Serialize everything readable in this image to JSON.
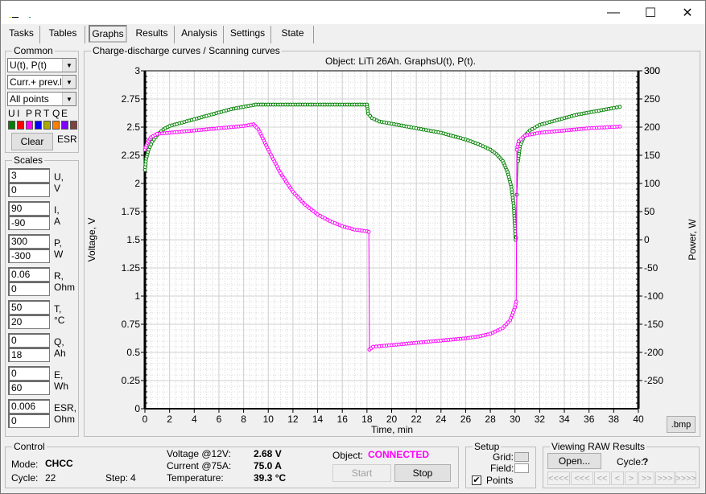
{
  "window": {
    "minimize_glyph": "—",
    "maximize_glyph": "☐",
    "close_glyph": "✕"
  },
  "tabs": [
    {
      "label": "Tasks",
      "active": false
    },
    {
      "label": "Tables",
      "active": false
    },
    {
      "label": "Graphs",
      "active": true
    },
    {
      "label": "Results",
      "active": false
    },
    {
      "label": "Analysis",
      "active": false
    },
    {
      "label": "Settings",
      "active": false
    },
    {
      "label": "State",
      "active": false
    }
  ],
  "common": {
    "title": "Common",
    "graph_select": "U(t), P(t)",
    "curve_select": "Curr.+ prev.L",
    "points_select": "All points",
    "legend_letters": [
      "U",
      "I",
      "P",
      "R",
      "T",
      "Q",
      "E"
    ],
    "legend_colors": [
      "#008000",
      "#ff0000",
      "#ff00ff",
      "#0000ff",
      "#aaaa00",
      "#ff8000",
      "#8000ff",
      "#804040"
    ],
    "clear_label": "Clear",
    "esr_label": "ESR"
  },
  "scales": {
    "title": "Scales",
    "rows": [
      {
        "max": "3",
        "min": "0",
        "unit1": "U,",
        "unit2": "V"
      },
      {
        "max": "90",
        "min": "-90",
        "unit1": "I,",
        "unit2": "A"
      },
      {
        "max": "300",
        "min": "-300",
        "unit1": "P,",
        "unit2": "W"
      },
      {
        "max": "0.06",
        "min": "0",
        "unit1": "R,",
        "unit2": "Ohm"
      },
      {
        "max": "50",
        "min": "20",
        "unit1": "T,",
        "unit2": "°C"
      },
      {
        "max": "0",
        "min": "18",
        "unit1": "Q,",
        "unit2": "Ah"
      },
      {
        "max": "0",
        "min": "60",
        "unit1": "E,",
        "unit2": "Wh"
      },
      {
        "max": "0.006",
        "min": "0",
        "unit1": "ESR,",
        "unit2": "Ohm"
      }
    ]
  },
  "graph_panel": {
    "title": "Charge-discharge curves / Scanning curves",
    "bmp_label": ".bmp"
  },
  "chart_data": {
    "type": "line",
    "title": "Object: LiTi 26Ah. GraphsU(t), P(t).",
    "xlabel": "Time, min",
    "ylabel": "Voltage, V",
    "y2label": "Power, W",
    "xlim": [
      0,
      40
    ],
    "ylim": [
      0,
      3
    ],
    "y2lim": [
      -300,
      300
    ],
    "xticks": [
      0,
      2,
      4,
      6,
      8,
      10,
      12,
      14,
      16,
      18,
      20,
      22,
      24,
      26,
      28,
      30,
      32,
      34,
      36,
      38,
      40
    ],
    "yticks": [
      "0",
      "0.25",
      "0.5",
      "0.75",
      "1",
      "1.25",
      "1.5",
      "1.75",
      "2",
      "2.25",
      "2.5",
      "2.75",
      "3"
    ],
    "y2ticks": [
      "-250",
      "-200",
      "-150",
      "-100",
      "-50",
      "0",
      "50",
      "100",
      "150",
      "200",
      "250",
      "300"
    ],
    "grid": true,
    "series": [
      {
        "name": "U",
        "axis": "left",
        "color": "#008000",
        "points": [
          [
            0,
            2.12
          ],
          [
            0.1,
            2.22
          ],
          [
            0.3,
            2.3
          ],
          [
            0.6,
            2.37
          ],
          [
            1.0,
            2.43
          ],
          [
            1.5,
            2.48
          ],
          [
            2.0,
            2.51
          ],
          [
            3.0,
            2.54
          ],
          [
            4.0,
            2.57
          ],
          [
            5.0,
            2.6
          ],
          [
            6.0,
            2.63
          ],
          [
            7.0,
            2.66
          ],
          [
            8.0,
            2.68
          ],
          [
            9.0,
            2.7
          ],
          [
            10,
            2.7
          ],
          [
            12,
            2.7
          ],
          [
            14,
            2.7
          ],
          [
            16,
            2.7
          ],
          [
            18.0,
            2.7
          ],
          [
            18.1,
            2.62
          ],
          [
            18.4,
            2.58
          ],
          [
            19,
            2.55
          ],
          [
            20,
            2.53
          ],
          [
            21,
            2.51
          ],
          [
            22,
            2.49
          ],
          [
            23,
            2.47
          ],
          [
            24,
            2.45
          ],
          [
            25,
            2.42
          ],
          [
            26,
            2.39
          ],
          [
            27,
            2.35
          ],
          [
            28,
            2.3
          ],
          [
            28.5,
            2.26
          ],
          [
            29,
            2.2
          ],
          [
            29.4,
            2.1
          ],
          [
            29.7,
            1.97
          ],
          [
            29.9,
            1.8
          ],
          [
            30.0,
            1.6
          ],
          [
            30.05,
            1.5
          ],
          [
            30.1,
            1.52
          ],
          [
            30.15,
            1.9
          ],
          [
            30.25,
            2.2
          ],
          [
            30.4,
            2.33
          ],
          [
            30.7,
            2.41
          ],
          [
            31.2,
            2.47
          ],
          [
            32,
            2.52
          ],
          [
            33,
            2.55
          ],
          [
            34,
            2.58
          ],
          [
            35,
            2.61
          ],
          [
            36,
            2.63
          ],
          [
            37,
            2.65
          ],
          [
            38,
            2.67
          ],
          [
            38.5,
            2.68
          ]
        ]
      },
      {
        "name": "P",
        "axis": "right",
        "color": "#ff00ff",
        "points": [
          [
            0,
            160
          ],
          [
            0.2,
            172
          ],
          [
            0.5,
            182
          ],
          [
            1.0,
            188
          ],
          [
            2.0,
            190
          ],
          [
            4.0,
            194
          ],
          [
            6.0,
            198
          ],
          [
            8.0,
            202
          ],
          [
            8.8,
            205
          ],
          [
            9.2,
            196
          ],
          [
            10,
            160
          ],
          [
            11,
            118
          ],
          [
            12,
            85
          ],
          [
            13,
            62
          ],
          [
            14,
            45
          ],
          [
            15,
            33
          ],
          [
            16,
            24
          ],
          [
            17,
            18
          ],
          [
            18.0,
            15
          ],
          [
            18.15,
            14
          ],
          [
            18.2,
            -195
          ],
          [
            18.5,
            -190
          ],
          [
            19,
            -189
          ],
          [
            20,
            -187
          ],
          [
            22,
            -183
          ],
          [
            24,
            -179
          ],
          [
            26,
            -175
          ],
          [
            27,
            -172
          ],
          [
            28,
            -167
          ],
          [
            29,
            -157
          ],
          [
            29.6,
            -143
          ],
          [
            30.0,
            -120
          ],
          [
            30.1,
            -110
          ],
          [
            30.15,
            160
          ],
          [
            30.3,
            175
          ],
          [
            30.8,
            185
          ],
          [
            32,
            190
          ],
          [
            34,
            194
          ],
          [
            36,
            198
          ],
          [
            38.5,
            201
          ]
        ]
      }
    ]
  },
  "control": {
    "title": "Control",
    "mode_label": "Mode:",
    "mode_value": "CHCC",
    "cycle_label": "Cycle:",
    "cycle_value": "22",
    "step_label": "Step:",
    "step_value": "4",
    "voltage_label": "Voltage @12V:",
    "voltage_value": "2.68 V",
    "current_label": "Current @75A:",
    "current_value": "75.0 A",
    "temperature_label": "Temperature:",
    "temperature_value": "39.3 °C",
    "object_label": "Object:",
    "object_status": "CONNECTED",
    "object_status_color": "#ff00ff",
    "start_label": "Start",
    "stop_label": "Stop"
  },
  "setup": {
    "title": "Setup",
    "grid_label": "Grid:",
    "grid_color": "#e0e0e0",
    "field_label": "Field:",
    "field_color": "#ffffff",
    "points_label": "Points",
    "points_checked": true
  },
  "viewing": {
    "title": "Viewing RAW Results",
    "open_label": "Open...",
    "cycle_label": "Cycle:",
    "cycle_value": "?",
    "nav_buttons": [
      "<<<<",
      "<<<",
      "<<",
      "<",
      ">",
      ">>",
      ">>>",
      ">>>>"
    ]
  }
}
